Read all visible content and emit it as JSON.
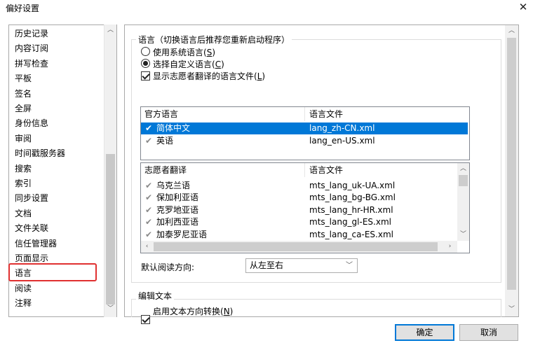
{
  "window": {
    "title": "偏好设置",
    "close_glyph": "✕"
  },
  "categories": [
    "历史记录",
    "内容订阅",
    "拼写检查",
    "平板",
    "签名",
    "全屏",
    "身份信息",
    "审阅",
    "时间戳服务器",
    "搜索",
    "索引",
    "同步设置",
    "文档",
    "文件关联",
    "信任管理器",
    "页面显示",
    "语言",
    "阅读",
    "注释"
  ],
  "selected_category": "语言",
  "language": {
    "group_title": "语言（切换语言后推荐您重新启动程序）",
    "use_system": {
      "label": "使用系统语言(",
      "key": "S",
      "suffix": ")",
      "selected": false
    },
    "use_custom": {
      "label": "选择自定义语言(",
      "key": "C",
      "suffix": ")",
      "selected": true
    },
    "show_volunteer": {
      "label": "显示志愿者翻译的语言文件(",
      "key": "L",
      "suffix": ")",
      "checked": true
    }
  },
  "official_list": {
    "col_language": "官方语言",
    "col_file": "语言文件",
    "rows": [
      {
        "language": "简体中文",
        "file": "lang_zh-CN.xml",
        "selected": true
      },
      {
        "language": "英语",
        "file": "lang_en-US.xml",
        "selected": false
      }
    ]
  },
  "volunteer_list": {
    "col_language": "志愿者翻译",
    "col_file": "语言文件",
    "rows": [
      {
        "language": "乌克兰语",
        "file": "mts_lang_uk-UA.xml"
      },
      {
        "language": "保加利亚语",
        "file": "mts_lang_bg-BG.xml"
      },
      {
        "language": "克罗地亚语",
        "file": "mts_lang_hr-HR.xml"
      },
      {
        "language": "加利西亚语",
        "file": "mts_lang_gl-ES.xml"
      },
      {
        "language": "加泰罗尼亚语",
        "file": "mts_lang_ca-ES.xml"
      }
    ]
  },
  "reading_direction": {
    "label": "默认阅读方向:",
    "value": "从左至右"
  },
  "edit_text": {
    "group_title": "编辑文本",
    "enable_direction": {
      "label": "启用文本方向转换(",
      "key": "N",
      "suffix": ")",
      "checked": true
    }
  },
  "buttons": {
    "ok": "确定",
    "cancel": "取消"
  },
  "icons": {
    "tick": "check-mark-icon",
    "scroll_up": "▲",
    "scroll_down": "▼",
    "scroll_left": "◀",
    "scroll_right": "▶",
    "dropdown": "chevron-down-icon"
  },
  "colors": {
    "selection": "#0078d7",
    "highlight_frame": "#e03030",
    "tick_green": "#3a9a3a"
  }
}
